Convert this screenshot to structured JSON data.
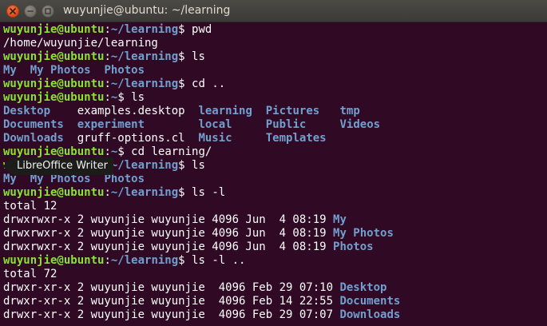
{
  "window": {
    "title": "wuyunjie@ubuntu: ~/learning",
    "buttons": {
      "close": "close-icon",
      "minimize": "minimize-icon",
      "maximize": "maximize-icon"
    }
  },
  "colors": {
    "background": "#300a24",
    "prompt_user": "#8ae234",
    "prompt_path": "#729fcf",
    "directory": "#729fcf",
    "text": "#ffffff"
  },
  "tooltip": {
    "label": "LibreOffice Writer"
  },
  "terminal": {
    "lines": [
      [
        {
          "t": "wuyunjie@ubuntu",
          "c": "prompt-user"
        },
        {
          "t": ":",
          "c": "text"
        },
        {
          "t": "~/learning",
          "c": "prompt-path"
        },
        {
          "t": "$ pwd",
          "c": "text"
        }
      ],
      [
        {
          "t": "/home/wuyunjie/learning",
          "c": "text"
        }
      ],
      [
        {
          "t": "wuyunjie@ubuntu",
          "c": "prompt-user"
        },
        {
          "t": ":",
          "c": "text"
        },
        {
          "t": "~/learning",
          "c": "prompt-path"
        },
        {
          "t": "$ ls",
          "c": "text"
        }
      ],
      [
        {
          "t": "My",
          "c": "dir"
        },
        {
          "t": "  ",
          "c": "text"
        },
        {
          "t": "My Photos",
          "c": "dir"
        },
        {
          "t": "  ",
          "c": "text"
        },
        {
          "t": "Photos",
          "c": "dir"
        }
      ],
      [
        {
          "t": "wuyunjie@ubuntu",
          "c": "prompt-user"
        },
        {
          "t": ":",
          "c": "text"
        },
        {
          "t": "~/learning",
          "c": "prompt-path"
        },
        {
          "t": "$ cd ..",
          "c": "text"
        }
      ],
      [
        {
          "t": "wuyunjie@ubuntu",
          "c": "prompt-user"
        },
        {
          "t": ":",
          "c": "text"
        },
        {
          "t": "~",
          "c": "prompt-path"
        },
        {
          "t": "$ ls",
          "c": "text"
        }
      ],
      [
        {
          "t": "Desktop",
          "c": "dir"
        },
        {
          "t": "    examples.desktop  ",
          "c": "text"
        },
        {
          "t": "learning",
          "c": "dir"
        },
        {
          "t": "  ",
          "c": "text"
        },
        {
          "t": "Pictures",
          "c": "dir"
        },
        {
          "t": "   ",
          "c": "text"
        },
        {
          "t": "tmp",
          "c": "dir"
        }
      ],
      [
        {
          "t": "Documents",
          "c": "dir"
        },
        {
          "t": "  ",
          "c": "text"
        },
        {
          "t": "experiment",
          "c": "dir"
        },
        {
          "t": "        ",
          "c": "text"
        },
        {
          "t": "local",
          "c": "dir"
        },
        {
          "t": "     ",
          "c": "text"
        },
        {
          "t": "Public",
          "c": "dir"
        },
        {
          "t": "     ",
          "c": "text"
        },
        {
          "t": "Videos",
          "c": "dir"
        }
      ],
      [
        {
          "t": "Downloads",
          "c": "dir"
        },
        {
          "t": "  gruff-options.cl  ",
          "c": "text"
        },
        {
          "t": "Music",
          "c": "dir"
        },
        {
          "t": "     ",
          "c": "text"
        },
        {
          "t": "Templates",
          "c": "dir"
        }
      ],
      [
        {
          "t": "wuyunjie@ubuntu",
          "c": "prompt-user"
        },
        {
          "t": ":",
          "c": "text"
        },
        {
          "t": "~",
          "c": "prompt-path"
        },
        {
          "t": "$ cd learning/",
          "c": "text"
        }
      ],
      [
        {
          "t": "wuyunjie@ubuntu",
          "c": "prompt-user"
        },
        {
          "t": ":",
          "c": "text"
        },
        {
          "t": "~/learning",
          "c": "prompt-path"
        },
        {
          "t": "$ ls",
          "c": "text"
        }
      ],
      [
        {
          "t": "My",
          "c": "dir"
        },
        {
          "t": "  ",
          "c": "text"
        },
        {
          "t": "My Photos",
          "c": "dir"
        },
        {
          "t": "  ",
          "c": "text"
        },
        {
          "t": "Photos",
          "c": "dir"
        }
      ],
      [
        {
          "t": "wuyunjie@ubuntu",
          "c": "prompt-user"
        },
        {
          "t": ":",
          "c": "text"
        },
        {
          "t": "~/learning",
          "c": "prompt-path"
        },
        {
          "t": "$ ls -l",
          "c": "text"
        }
      ],
      [
        {
          "t": "total 12",
          "c": "text"
        }
      ],
      [
        {
          "t": "drwxrwxr-x 2 wuyunjie wuyunjie 4096 Jun  4 08:19 ",
          "c": "text"
        },
        {
          "t": "My",
          "c": "dir"
        }
      ],
      [
        {
          "t": "drwxrwxr-x 2 wuyunjie wuyunjie 4096 Jun  4 08:19 ",
          "c": "text"
        },
        {
          "t": "My Photos",
          "c": "dir"
        }
      ],
      [
        {
          "t": "drwxrwxr-x 2 wuyunjie wuyunjie 4096 Jun  4 08:19 ",
          "c": "text"
        },
        {
          "t": "Photos",
          "c": "dir"
        }
      ],
      [
        {
          "t": "wuyunjie@ubuntu",
          "c": "prompt-user"
        },
        {
          "t": ":",
          "c": "text"
        },
        {
          "t": "~/learning",
          "c": "prompt-path"
        },
        {
          "t": "$ ls -l ..",
          "c": "text"
        }
      ],
      [
        {
          "t": "total 72",
          "c": "text"
        }
      ],
      [
        {
          "t": "drwxr-xr-x 2 wuyunjie wuyunjie  4096 Feb 29 07:10 ",
          "c": "text"
        },
        {
          "t": "Desktop",
          "c": "dir"
        }
      ],
      [
        {
          "t": "drwxr-xr-x 2 wuyunjie wuyunjie  4096 Feb 14 22:55 ",
          "c": "text"
        },
        {
          "t": "Documents",
          "c": "dir"
        }
      ],
      [
        {
          "t": "drwxr-xr-x 2 wuyunjie wuyunjie  4096 Feb 29 07:07 ",
          "c": "text"
        },
        {
          "t": "Downloads",
          "c": "dir"
        }
      ]
    ]
  }
}
